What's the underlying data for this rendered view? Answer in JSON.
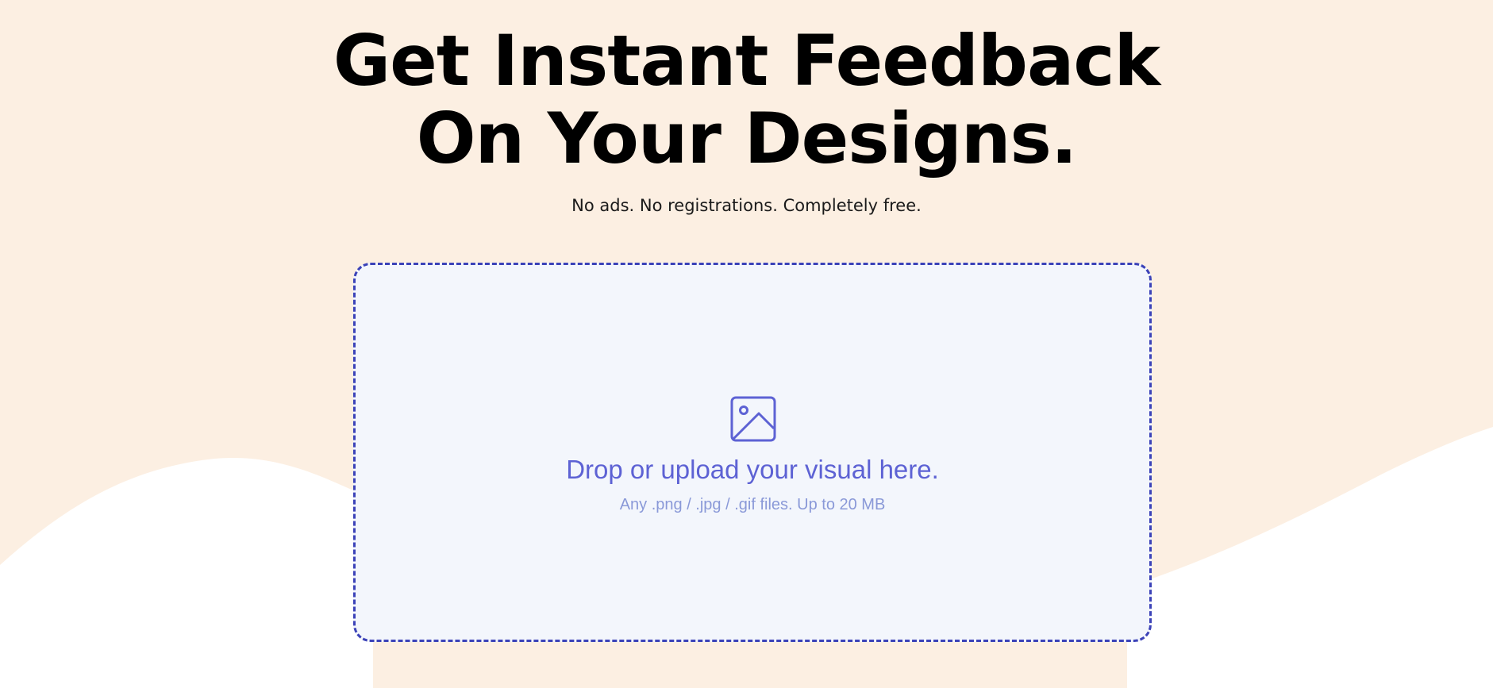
{
  "hero": {
    "title_line1": "Get Instant Feedback",
    "title_line2": "On Your Designs.",
    "subtitle": "No ads. No registrations. Completely free."
  },
  "dropzone": {
    "icon": "image-icon",
    "title": "Drop or upload your visual here.",
    "hint": "Any .png / .jpg / .gif files. Up to 20 MB"
  },
  "colors": {
    "background_peach": "#fcefe2",
    "background_white": "#ffffff",
    "dropzone_border": "#3b42b8",
    "dropzone_fill": "#f3f6fc",
    "accent_text": "#5d62d4",
    "hint_text": "#8a99d8"
  }
}
